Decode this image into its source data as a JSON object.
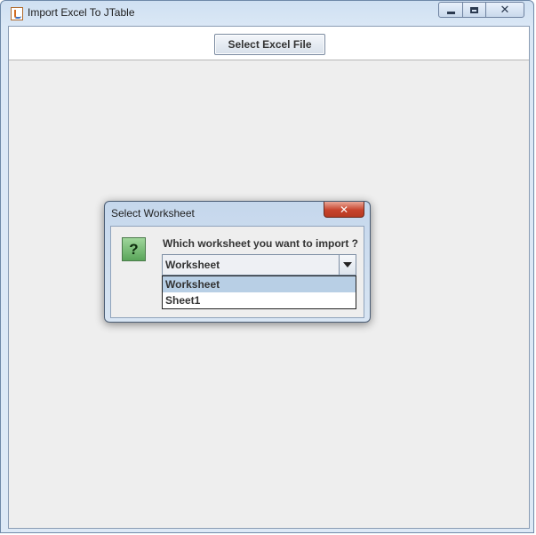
{
  "window": {
    "title": "Import Excel To JTable",
    "controls": {
      "minimize": "minimize",
      "maximize": "maximize",
      "close": "✕"
    }
  },
  "toolbar": {
    "select_button_label": "Select Excel File"
  },
  "dialog": {
    "title": "Select Worksheet",
    "close_label": "✕",
    "icon_glyph": "?",
    "prompt": "Which worksheet you want to import ?",
    "combo_value": "Worksheet",
    "options": [
      "Worksheet",
      "Sheet1"
    ],
    "selected_index": 0
  },
  "colors": {
    "selection_highlight": "#b8cfe5",
    "close_button": "#c7432c",
    "question_icon": "#5aa55a"
  }
}
